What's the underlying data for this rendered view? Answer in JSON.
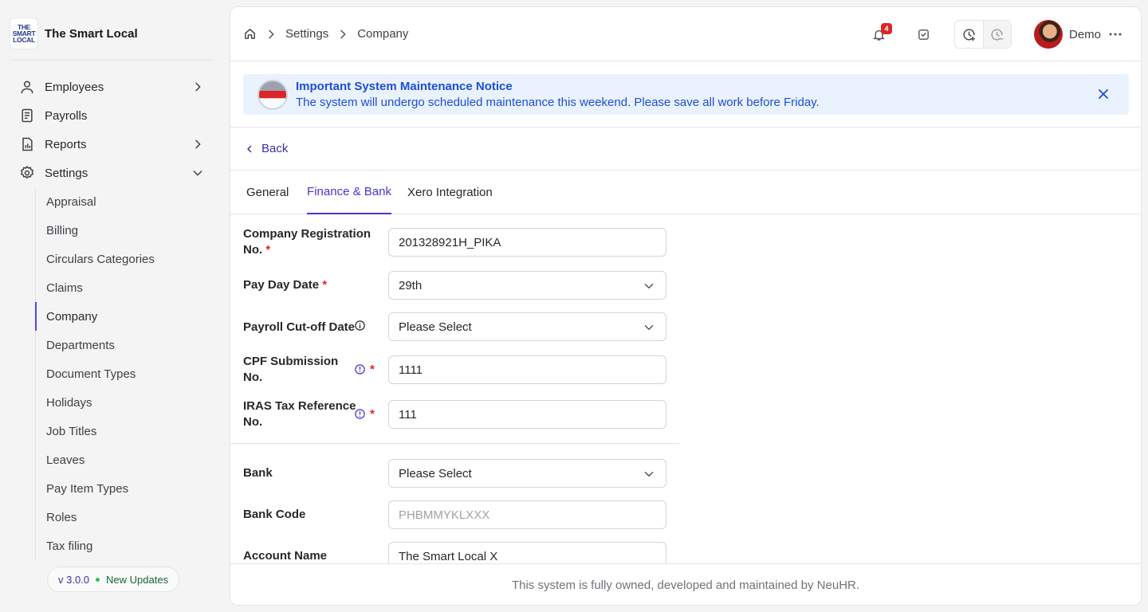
{
  "brand": {
    "name": "The Smart Local",
    "logo_lines": [
      "THE",
      "SMART",
      "LOCAL"
    ]
  },
  "sidebar": {
    "items": [
      {
        "label": "Employees",
        "icon": "user-icon",
        "has_chevron": true
      },
      {
        "label": "Payrolls",
        "icon": "receipt-icon",
        "has_chevron": false
      },
      {
        "label": "Reports",
        "icon": "report-icon",
        "has_chevron": true
      },
      {
        "label": "Settings",
        "icon": "gear-icon",
        "has_chevron": true,
        "expanded": true
      }
    ],
    "settings_children": [
      "Appraisal",
      "Billing",
      "Circulars Categories",
      "Claims",
      "Company",
      "Departments",
      "Document Types",
      "Holidays",
      "Job Titles",
      "Leaves",
      "Pay Item Types",
      "Roles",
      "Tax filing"
    ],
    "active_child": "Company",
    "version": "v 3.0.0",
    "updates_label": "New Updates"
  },
  "breadcrumb": {
    "items": [
      "Settings",
      "Company"
    ]
  },
  "header": {
    "notification_count": "4",
    "user_name": "Demo"
  },
  "notice": {
    "title": "Important System Maintenance Notice",
    "message": "The system will undergo scheduled maintenance this weekend. Please save all work before Friday."
  },
  "back_label": "Back",
  "tabs": [
    "General",
    "Finance & Bank",
    "Xero Integration"
  ],
  "active_tab": "Finance & Bank",
  "form": {
    "company_reg": {
      "label_line1": "Company Registration",
      "label_line2": "No.",
      "value": "201328921H_PIKA"
    },
    "pay_day": {
      "label": "Pay Day Date",
      "value": "29th"
    },
    "payroll_cutoff": {
      "label": "Payroll Cut-off Date",
      "value": "Please Select"
    },
    "cpf": {
      "label_line1": "CPF Submission",
      "label_line2": "No.",
      "value": "1111"
    },
    "iras": {
      "label_line1": "IRAS Tax Reference",
      "label_line2": "No.",
      "value": "111"
    },
    "bank": {
      "label": "Bank",
      "value": "Please Select"
    },
    "bank_code": {
      "label": "Bank Code",
      "placeholder": "PHBMMYKLXXX"
    },
    "account_name": {
      "label": "Account Name",
      "value": "The Smart Local X"
    }
  },
  "footer": {
    "text": "This system is fully owned, developed and maintained by NeuHR."
  },
  "colors": {
    "accent": "#4338ca",
    "required": "#dc2626",
    "notice_bg": "#eaf2fd",
    "notice_text": "#1d4ed8"
  }
}
